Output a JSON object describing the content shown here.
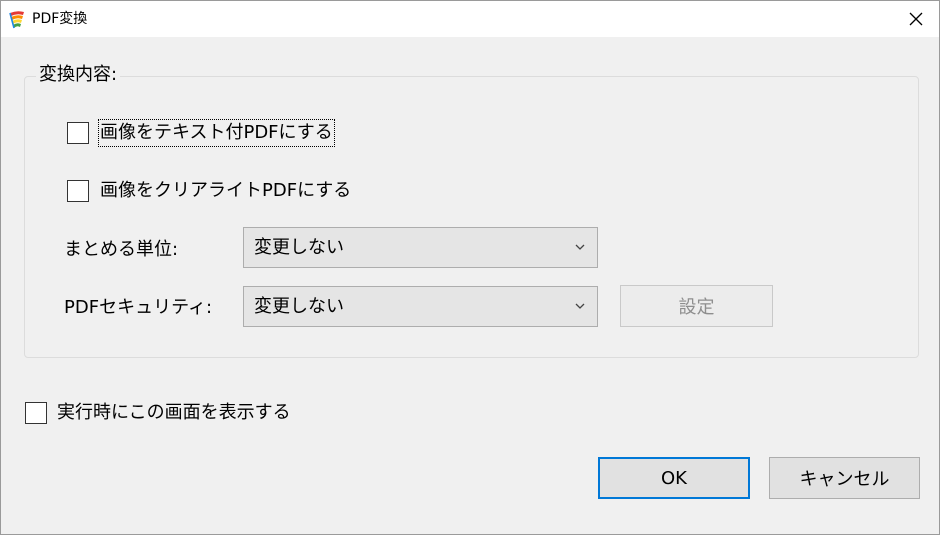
{
  "window": {
    "title": "PDF変換",
    "close_glyph": "✕"
  },
  "group": {
    "title": "変換内容:",
    "checkbox_text_pdf": {
      "label": "画像をテキスト付PDFにする",
      "checked": false
    },
    "checkbox_clear_light": {
      "label": "画像をクリアライトPDFにする",
      "checked": false
    },
    "unit": {
      "label": "まとめる単位:",
      "value": "変更しない"
    },
    "security": {
      "label": "PDFセキュリティ:",
      "value": "変更しない",
      "settings_label": "設定"
    }
  },
  "show_on_run": {
    "label": "実行時にこの画面を表示する",
    "checked": false
  },
  "buttons": {
    "ok": "OK",
    "cancel": "キャンセル"
  },
  "icons": {
    "app": "pdf-converter-app-icon",
    "close": "close-icon",
    "dropdown": "chevron-down-icon"
  },
  "colors": {
    "accent": "#0078d7",
    "background": "#f0f0f0",
    "titlebar": "#ffffff"
  }
}
